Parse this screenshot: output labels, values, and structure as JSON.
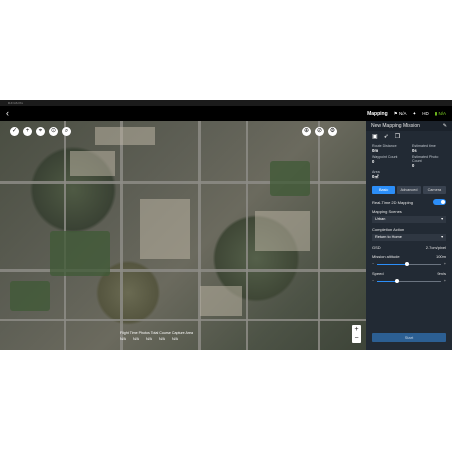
{
  "window": {
    "title": "DJI GS Pro"
  },
  "topbar": {
    "back": "‹",
    "mode": "Mapping",
    "gps": "N/A",
    "rc": "HD",
    "battery": "N/A"
  },
  "map": {
    "tools_left": [
      "✓",
      "+",
      "⌖",
      "⊙",
      "⌕"
    ],
    "tools_right": [
      "⊕",
      "⊘",
      "⚙"
    ],
    "zoom": {
      "plus": "+",
      "minus": "−"
    },
    "scale_label": "Flight Time  Photos  Total Course Capture Area",
    "scale_values": [
      "N/A",
      "N/A",
      "N/A",
      "N/A",
      "N/A"
    ]
  },
  "panel": {
    "title": "New Mapping Mission",
    "stats": [
      {
        "label": "Route Distance",
        "value": "0m"
      },
      {
        "label": "Estimated time",
        "value": "0s"
      },
      {
        "label": "Waypoint Count",
        "value": "0"
      },
      {
        "label": "Estimated Photo Count",
        "value": "0"
      },
      {
        "label": "Area",
        "value": "0㎡"
      }
    ],
    "tabs": [
      "Basic",
      "Advanced",
      "Camera"
    ],
    "realtime_label": "Real-Time 2D Mapping",
    "mapping_scenes_label": "Mapping Scenes",
    "mapping_scenes_value": "Urban",
    "completion_label": "Completion Action",
    "completion_value": "Return to Home",
    "gsd_label": "GSD",
    "gsd_value": "2.7cm/pixel",
    "altitude_label": "Mission altitude",
    "altitude_value": "100m",
    "speed_label": "Speed",
    "speed_value": "9m/s",
    "start_label": "Start"
  }
}
